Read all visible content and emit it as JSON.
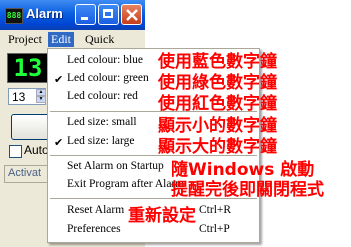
{
  "window": {
    "title": "Alarm",
    "icon_text": "888",
    "clock_display": "13",
    "spin_value": "13",
    "auto_label": "Auto",
    "status_text": "Activat"
  },
  "menubar": {
    "items": [
      "Project",
      "Edit",
      "Quick"
    ],
    "active": "Edit"
  },
  "edit_menu": {
    "items": [
      {
        "label": "Led colour: blue",
        "checked": false
      },
      {
        "label": "Led colour: green",
        "checked": true
      },
      {
        "label": "Led colour: red",
        "checked": false
      },
      {
        "label": "Led size: small",
        "checked": false
      },
      {
        "label": "Led size: large",
        "checked": true
      },
      {
        "label": "Set Alarm on Startup",
        "checked": false
      },
      {
        "label": "Exit Program after Alarm",
        "checked": false
      },
      {
        "label": "Reset Alarm",
        "shortcut": "Ctrl+R"
      },
      {
        "label": "Preferences",
        "shortcut": "Ctrl+P"
      }
    ],
    "check_glyph": "✔"
  },
  "annotations": [
    "使用藍色數字鐘",
    "使用綠色數字鐘",
    "使用紅色數字鐘",
    "顯示小的數字鐘",
    "顯示大的數字鐘",
    "隨Windows 啟動",
    "提醒完後即關閉程式",
    "重新設定"
  ],
  "colors": {
    "annotation": "#ff0000",
    "led": "#1fff3a",
    "titlebar": "#0a5fe0"
  }
}
